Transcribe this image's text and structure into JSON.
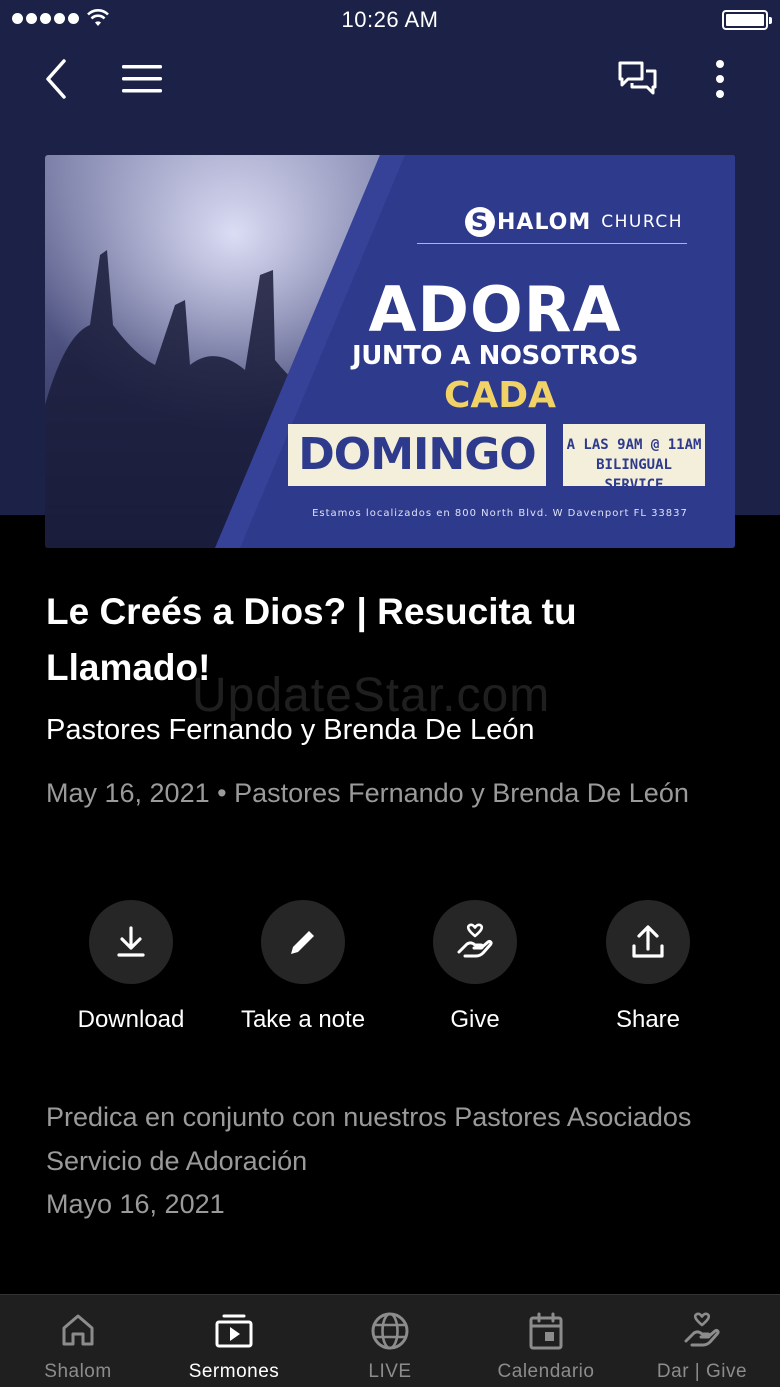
{
  "status_bar": {
    "time": "10:26 AM"
  },
  "banner": {
    "brand_initial": "S",
    "brand_name": "HALOM",
    "brand_suffix": "CHURCH",
    "headline": "ADORA",
    "subheadline": "JUNTO A NOSOTROS",
    "highlight": "CADA",
    "day": "DOMINGO",
    "times_line1": "A LAS 9AM @ 11AM",
    "times_line2": "BILINGUAL SERVICE",
    "address": "Estamos localizados en  800 North Blvd. W  Davenport FL 33837"
  },
  "sermon": {
    "title": "Le Creés a Dios? | Resucita tu Llamado!",
    "speaker": "Pastores Fernando y Brenda De León",
    "meta": "May 16, 2021 • Pastores Fernando y Brenda De León"
  },
  "watermark": "UpdateStar.com",
  "actions": [
    {
      "label": "Download",
      "icon": "download-icon"
    },
    {
      "label": "Take a note",
      "icon": "pencil-icon"
    },
    {
      "label": "Give",
      "icon": "give-hand-heart-icon"
    },
    {
      "label": "Share",
      "icon": "share-icon"
    }
  ],
  "description": [
    "Predica en conjunto con nuestros Pastores Asociados",
    "Servicio de Adoración",
    "Mayo 16, 2021"
  ],
  "tabs": [
    {
      "label": "Shalom",
      "icon": "home-icon",
      "active": false
    },
    {
      "label": "Sermones",
      "icon": "sermons-play-icon",
      "active": true
    },
    {
      "label": "LIVE",
      "icon": "globe-icon",
      "active": false
    },
    {
      "label": "Calendario",
      "icon": "calendar-icon",
      "active": false
    },
    {
      "label": "Dar | Give",
      "icon": "give-hand-heart-icon",
      "active": false
    }
  ],
  "colors": {
    "header_bg": "#1c2147",
    "banner_blue": "#2e3a8c",
    "banner_gold": "#f1d266",
    "tabbar_bg": "#1f1f1f",
    "muted_text": "#9a9a9a"
  }
}
